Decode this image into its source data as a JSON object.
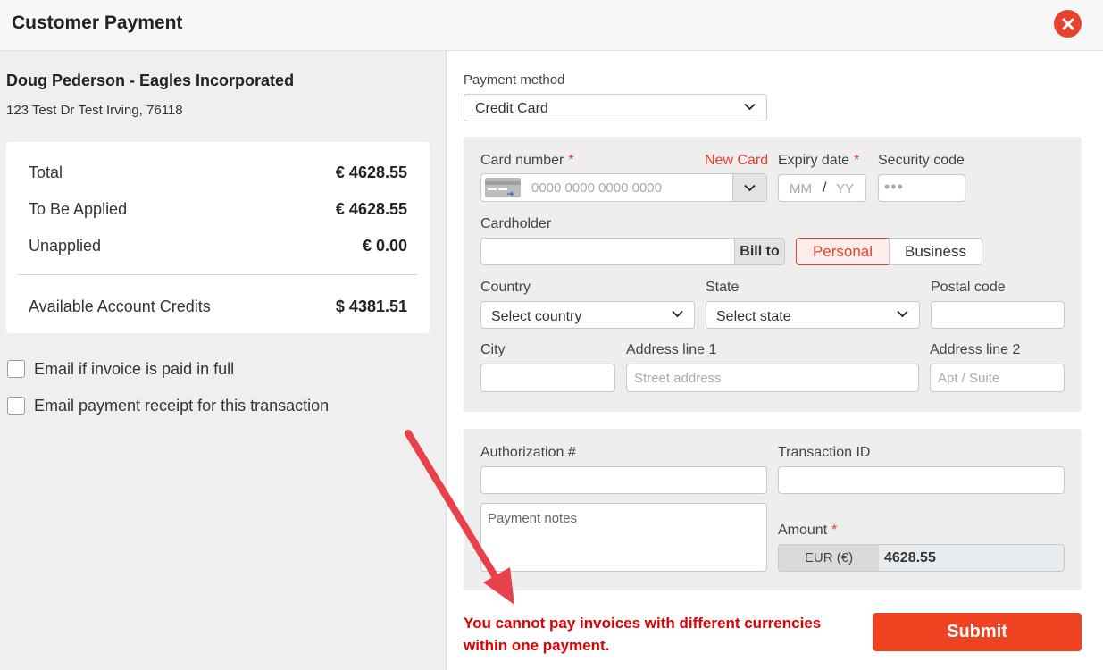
{
  "header": {
    "title": "Customer Payment",
    "close_icon": "close-icon"
  },
  "customer": {
    "name": "Doug Pederson - Eagles Incorporated",
    "address": "123 Test Dr Test Irving, 76118"
  },
  "summary": {
    "total_label": "Total",
    "total_value": "€ 4628.55",
    "applied_label": "To Be Applied",
    "applied_value": "€ 4628.55",
    "unapplied_label": "Unapplied",
    "unapplied_value": "€ 0.00",
    "credits_label": "Available Account Credits",
    "credits_value": "$ 4381.51"
  },
  "options": {
    "email_paid_full": "Email if invoice is paid in full",
    "email_receipt": "Email payment receipt for this transaction"
  },
  "payment_method": {
    "label": "Payment method",
    "value": "Credit Card"
  },
  "card": {
    "number_label": "Card number",
    "new_card": "New Card",
    "number_placeholder": "0000 0000 0000 0000",
    "expiry_label": "Expiry date",
    "expiry_mm": "MM",
    "expiry_sep": "/",
    "expiry_yy": "YY",
    "security_label": "Security code",
    "security_placeholder": "•••",
    "cardholder_label": "Cardholder",
    "bill_to": "Bill to",
    "personal": "Personal",
    "business": "Business",
    "country_label": "Country",
    "country_value": "Select country",
    "state_label": "State",
    "state_value": "Select state",
    "postal_label": "Postal code",
    "city_label": "City",
    "address1_label": "Address line 1",
    "address1_placeholder": "Street address",
    "address2_label": "Address line 2",
    "address2_placeholder": "Apt / Suite"
  },
  "transaction": {
    "auth_label": "Authorization #",
    "txn_label": "Transaction ID",
    "notes_placeholder": "Payment notes",
    "amount_label": "Amount",
    "currency": "EUR (€)",
    "amount_value": "4628.55"
  },
  "required_mark": "*",
  "error_message": "You cannot pay invoices with different currencies within one payment.",
  "submit_label": "Submit",
  "colors": {
    "accent": "#e8412c",
    "error": "#e00000",
    "submit": "#ee4320",
    "arrow": "#e8414b"
  }
}
